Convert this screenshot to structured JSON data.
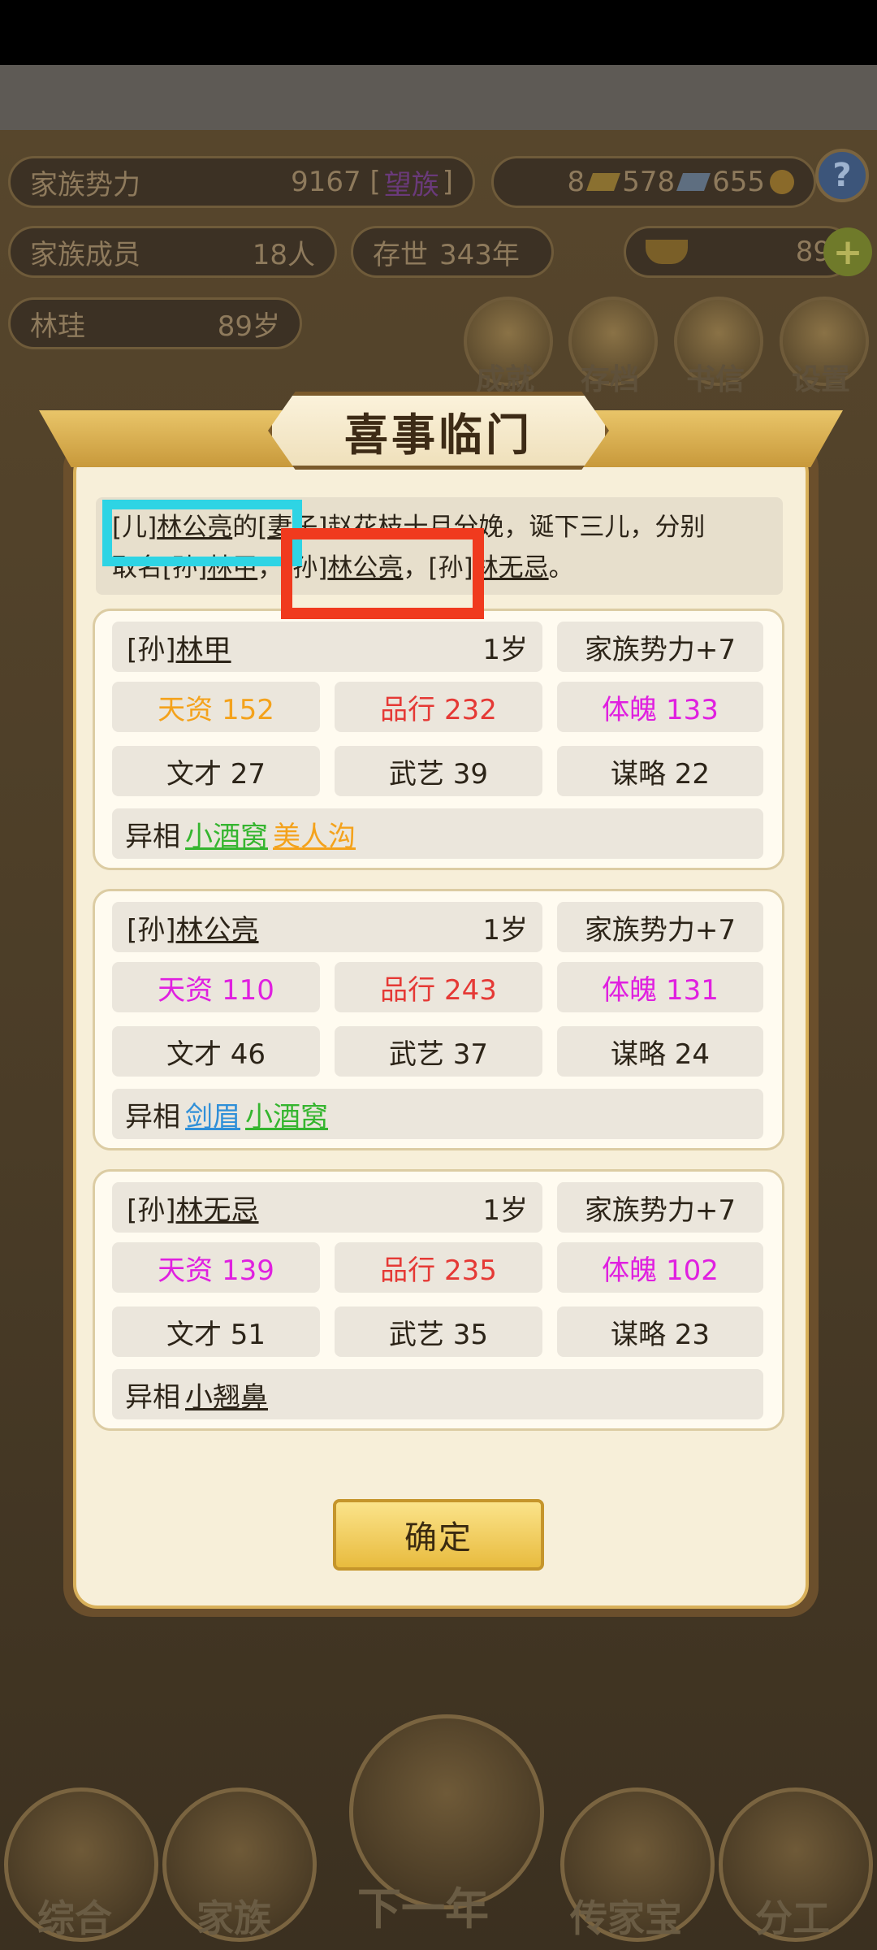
{
  "colors": {
    "talent": "#f4a21b",
    "conduct": "#e53935",
    "physique": "#e020e0",
    "trait_green": "#35b52f",
    "trait_orange": "#f4a21b",
    "trait_blue": "#2f8fd8"
  },
  "header": {
    "family_power_label": "家族势力",
    "family_power_value": "9167 [",
    "family_power_rank": "望族",
    "family_power_close": "]",
    "res_1": "8",
    "res_2": "578",
    "res_3": "655",
    "help_icon": "question-icon",
    "members_label": "家族成员",
    "members_value": "18人",
    "alive_label": "存世",
    "alive_value": "343年",
    "gold_value": "89",
    "patriarch_name": "林珪",
    "patriarch_age": "89岁"
  },
  "top_buttons": [
    {
      "label": "成就"
    },
    {
      "label": "存档"
    },
    {
      "label": "书信"
    },
    {
      "label": "设置"
    }
  ],
  "bottom_nav": [
    {
      "label": "综合"
    },
    {
      "label": "家族"
    },
    {
      "label": "下一年"
    },
    {
      "label": "传家宝"
    },
    {
      "label": "分工"
    }
  ],
  "dialog": {
    "title": "喜事临门",
    "message": {
      "l1_a": "[儿]",
      "l1_b": "林公亮",
      "l1_c": "的[",
      "l1_d": "妻子",
      "l1_e": "]赵花枝十月分娩，诞下三儿，分别",
      "l2_a": "取名[孙]",
      "l2_b": "林甲",
      "l2_c": "，[孙]",
      "l2_d": "林公亮",
      "l2_e": "，[孙]",
      "l2_f": "林无忌",
      "l2_g": "。"
    },
    "children": [
      {
        "prefix": "[孙]",
        "name": "林甲",
        "age": "1岁",
        "power": "家族势力+7",
        "talent": "天资 152",
        "conduct": "品行 232",
        "physique": "体魄 133",
        "literary": "文才 27",
        "martial": "武艺 39",
        "strategy": "谋略 22",
        "traits_label": "异相",
        "trait_1": "小酒窝",
        "trait_2": "美人沟"
      },
      {
        "prefix": "[孙]",
        "name": "林公亮",
        "age": "1岁",
        "power": "家族势力+7",
        "talent": "天资 110",
        "conduct": "品行 243",
        "physique": "体魄 131",
        "literary": "文才 46",
        "martial": "武艺 37",
        "strategy": "谋略 24",
        "traits_label": "异相",
        "trait_1": "剑眉",
        "trait_2": "小酒窝"
      },
      {
        "prefix": "[孙]",
        "name": "林无忌",
        "age": "1岁",
        "power": "家族势力+7",
        "talent": "天资 139",
        "conduct": "品行 235",
        "physique": "体魄 102",
        "literary": "文才 51",
        "martial": "武艺 35",
        "strategy": "谋略 23",
        "traits_label": "异相",
        "trait_1": "小翘鼻"
      }
    ],
    "confirm_label": "确定"
  }
}
